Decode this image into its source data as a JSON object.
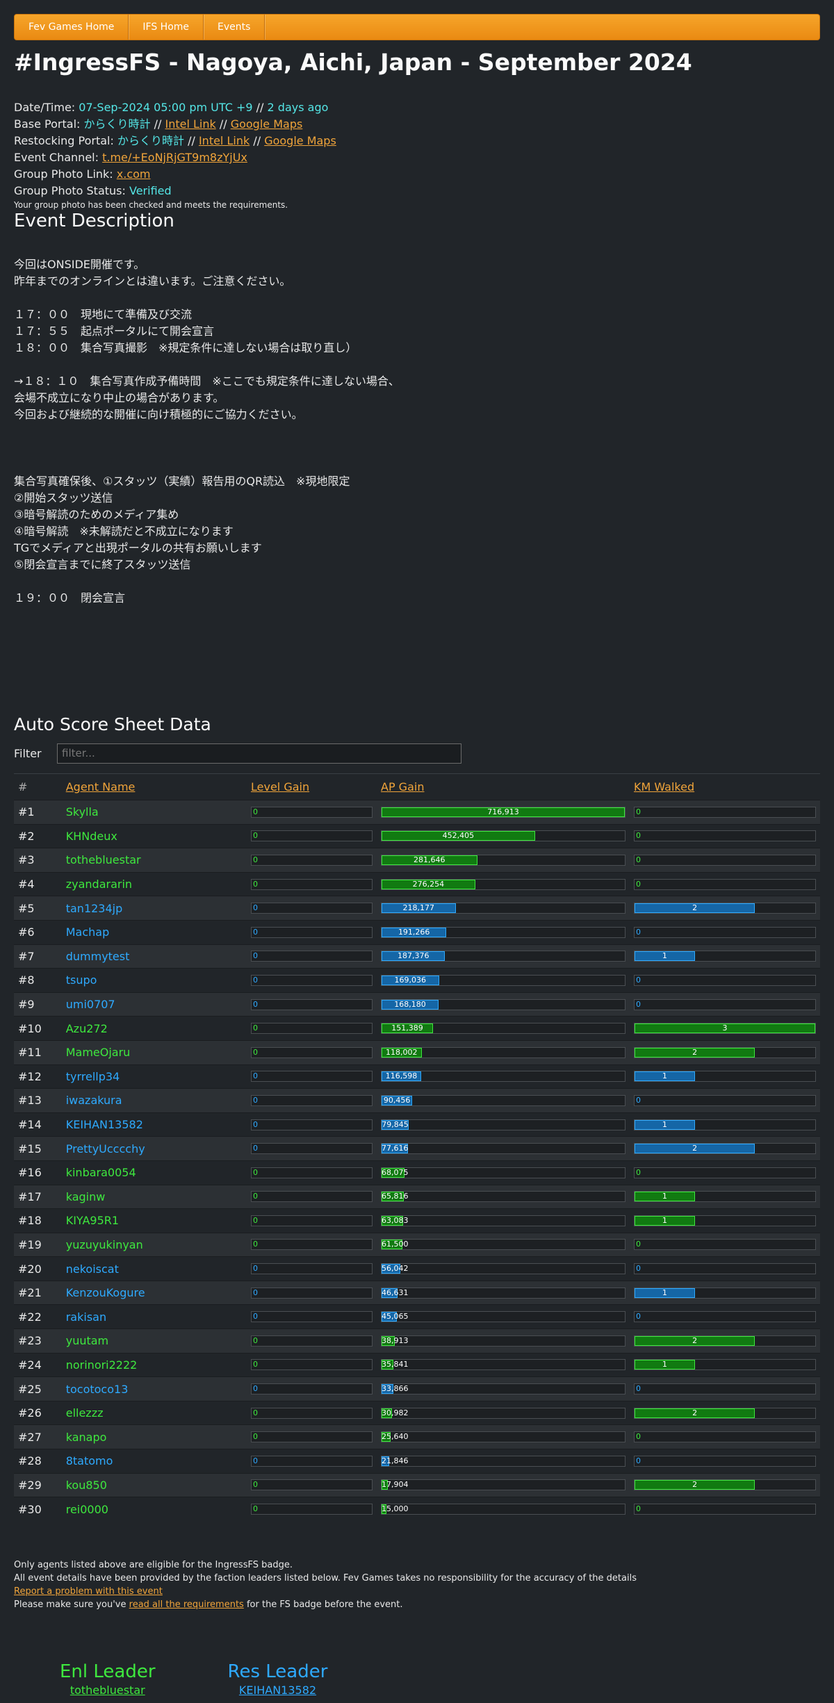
{
  "nav": [
    "Fev Games Home",
    "IFS Home",
    "Events"
  ],
  "title": "#IngressFS - Nagoya, Aichi, Japan - September 2024",
  "info": {
    "datetime_label": "Date/Time:",
    "datetime_value": "07-Sep-2024 05:00 pm UTC +9",
    "datetime_sep": " // ",
    "datetime_ago": "2 days ago",
    "base_label": "Base Portal:",
    "base_name": "からくり時計",
    "restock_label": "Restocking Portal:",
    "restock_name": "からくり時計",
    "sep": " // ",
    "intel_link": "Intel Link",
    "maps_link": "Google Maps",
    "channel_label": "Event Channel:",
    "channel_value": "t.me/+EoNjRjGT9m8zYjUx",
    "photo_link_label": "Group Photo Link:",
    "photo_link_value": "x.com",
    "photo_status_label": "Group Photo Status:",
    "photo_status_value": "Verified",
    "photo_note": "Your group photo has been checked and meets the requirements."
  },
  "description_heading": "Event Description",
  "description": "今回はONSIDE開催です。\n昨年までのオンラインとは違います。ご注意ください。\n\n１７：００　現地にて準備及び交流\n１７：５５　起点ポータルにて開会宣言\n１８：００　集合写真撮影　※規定条件に達しない場合は取り直し）\n\n→１８：１０　集合写真作成予備時間　※ここでも規定条件に達しない場合、\n会場不成立になり中止の場合があります。\n今回および継続的な開催に向け積極的にご協力ください。\n\n\n\n集合写真確保後、①スタッツ（実績）報告用のQR読込　※現地限定\n②開始スタッツ送信\n③暗号解読のためのメディア集め\n④暗号解読　※未解読だと不成立になります\nTGでメディアと出現ポータルの共有お願いします\n⑤閉会宣言までに終了スタッツ送信\n\n１９：００　閉会宣言",
  "score": {
    "heading": "Auto Score Sheet Data",
    "filter_label": "Filter",
    "filter_placeholder": "filter...",
    "columns": [
      "#",
      "Agent Name",
      "Level Gain",
      "AP Gain",
      "KM Walked"
    ],
    "ap_max": 716913,
    "km_max": 3,
    "rows": [
      {
        "rank": "#1",
        "name": "Skylla",
        "faction": "enl",
        "level": "0",
        "ap": 716913,
        "ap_label": "716,913",
        "km": 0
      },
      {
        "rank": "#2",
        "name": "KHNdeux",
        "faction": "enl",
        "level": "0",
        "ap": 452405,
        "ap_label": "452,405",
        "km": 0
      },
      {
        "rank": "#3",
        "name": "tothebluestar",
        "faction": "enl",
        "level": "0",
        "ap": 281646,
        "ap_label": "281,646",
        "km": 0
      },
      {
        "rank": "#4",
        "name": "zyandararin",
        "faction": "enl",
        "level": "0",
        "ap": 276254,
        "ap_label": "276,254",
        "km": 0
      },
      {
        "rank": "#5",
        "name": "tan1234jp",
        "faction": "res",
        "level": "0",
        "ap": 218177,
        "ap_label": "218,177",
        "km": 2
      },
      {
        "rank": "#6",
        "name": "Machap",
        "faction": "res",
        "level": "0",
        "ap": 191266,
        "ap_label": "191,266",
        "km": 0
      },
      {
        "rank": "#7",
        "name": "dummytest",
        "faction": "res",
        "level": "0",
        "ap": 187376,
        "ap_label": "187,376",
        "km": 1
      },
      {
        "rank": "#8",
        "name": "tsupo",
        "faction": "res",
        "level": "0",
        "ap": 169036,
        "ap_label": "169,036",
        "km": 0
      },
      {
        "rank": "#9",
        "name": "umi0707",
        "faction": "res",
        "level": "0",
        "ap": 168180,
        "ap_label": "168,180",
        "km": 0
      },
      {
        "rank": "#10",
        "name": "Azu272",
        "faction": "enl",
        "level": "0",
        "ap": 151389,
        "ap_label": "151,389",
        "km": 3
      },
      {
        "rank": "#11",
        "name": "MameOjaru",
        "faction": "enl",
        "level": "0",
        "ap": 118002,
        "ap_label": "118,002",
        "km": 2
      },
      {
        "rank": "#12",
        "name": "tyrrellp34",
        "faction": "res",
        "level": "0",
        "ap": 116598,
        "ap_label": "116,598",
        "km": 1
      },
      {
        "rank": "#13",
        "name": "iwazakura",
        "faction": "res",
        "level": "0",
        "ap": 90456,
        "ap_label": "90,456",
        "km": 0
      },
      {
        "rank": "#14",
        "name": "KEIHAN13582",
        "faction": "res",
        "level": "0",
        "ap": 79845,
        "ap_label": "79,845",
        "km": 1
      },
      {
        "rank": "#15",
        "name": "PrettyUcccchy",
        "faction": "res",
        "level": "0",
        "ap": 77616,
        "ap_label": "77,616",
        "km": 2
      },
      {
        "rank": "#16",
        "name": "kinbara0054",
        "faction": "enl",
        "level": "0",
        "ap": 68075,
        "ap_label": "68,075",
        "km": 0
      },
      {
        "rank": "#17",
        "name": "kaginw",
        "faction": "enl",
        "level": "0",
        "ap": 65816,
        "ap_label": "65,816",
        "km": 1
      },
      {
        "rank": "#18",
        "name": "KIYA95R1",
        "faction": "enl",
        "level": "0",
        "ap": 63083,
        "ap_label": "63,083",
        "km": 1
      },
      {
        "rank": "#19",
        "name": "yuzuyukinyan",
        "faction": "enl",
        "level": "0",
        "ap": 61500,
        "ap_label": "61,500",
        "km": 0
      },
      {
        "rank": "#20",
        "name": "nekoiscat",
        "faction": "res",
        "level": "0",
        "ap": 56042,
        "ap_label": "56,042",
        "km": 0
      },
      {
        "rank": "#21",
        "name": "KenzouKogure",
        "faction": "res",
        "level": "0",
        "ap": 46631,
        "ap_label": "46,631",
        "km": 1
      },
      {
        "rank": "#22",
        "name": "rakisan",
        "faction": "res",
        "level": "0",
        "ap": 45065,
        "ap_label": "45,065",
        "km": 0
      },
      {
        "rank": "#23",
        "name": "yuutam",
        "faction": "enl",
        "level": "0",
        "ap": 38913,
        "ap_label": "38,913",
        "km": 2
      },
      {
        "rank": "#24",
        "name": "norinori2222",
        "faction": "enl",
        "level": "0",
        "ap": 35841,
        "ap_label": "35,841",
        "km": 1
      },
      {
        "rank": "#25",
        "name": "tocotoco13",
        "faction": "res",
        "level": "0",
        "ap": 33866,
        "ap_label": "33,866",
        "km": 0
      },
      {
        "rank": "#26",
        "name": "ellezzz",
        "faction": "enl",
        "level": "0",
        "ap": 30982,
        "ap_label": "30,982",
        "km": 2
      },
      {
        "rank": "#27",
        "name": "kanapo",
        "faction": "enl",
        "level": "0",
        "ap": 25640,
        "ap_label": "25,640",
        "km": 0
      },
      {
        "rank": "#28",
        "name": "8tatomo",
        "faction": "res",
        "level": "0",
        "ap": 21846,
        "ap_label": "21,846",
        "km": 0
      },
      {
        "rank": "#29",
        "name": "kou850",
        "faction": "enl",
        "level": "0",
        "ap": 17904,
        "ap_label": "17,904",
        "km": 2
      },
      {
        "rank": "#30",
        "name": "rei0000",
        "faction": "enl",
        "level": "0",
        "ap": 15000,
        "ap_label": "15,000",
        "km": 0
      }
    ]
  },
  "footer": {
    "line1": "Only agents listed above are eligible for the IngressFS badge.",
    "line2": "All event details have been provided by the faction leaders listed below. Fev Games takes no responsibility for the accuracy of the details",
    "report_link": "Report a problem with this event",
    "req_prefix": "Please make sure you've ",
    "req_link": "read all the requirements",
    "req_suffix": " for the FS badge before the event."
  },
  "leaders": {
    "enl_title": "Enl Leader",
    "enl_name": "tothebluestar",
    "res_title": "Res Leader",
    "res_name": "KEIHAN13582"
  },
  "colors": {
    "enl": "#3ee83e",
    "res": "#2eaaff",
    "accent": "#f0a43a",
    "background": "#212529"
  }
}
